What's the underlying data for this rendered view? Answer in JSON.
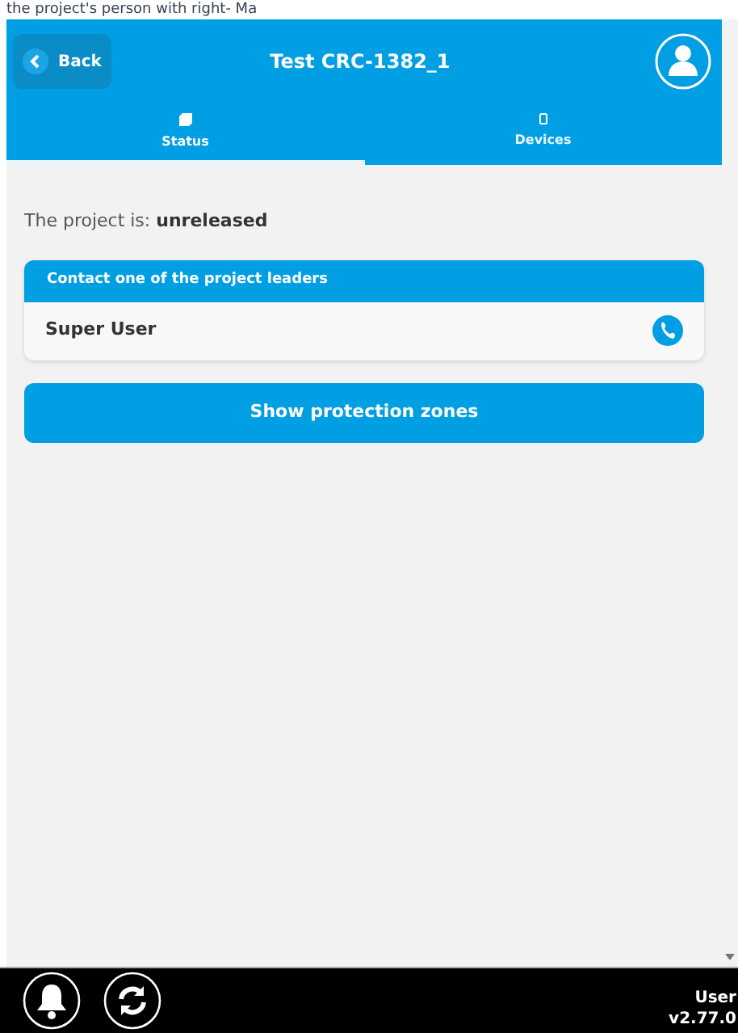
{
  "overlay_text": "the project's person with right- Ma",
  "header": {
    "back": "Back",
    "title": "Test CRC-1382_1"
  },
  "tabs": [
    {
      "label": "Status",
      "selected": true
    },
    {
      "label": "Devices",
      "selected": false
    }
  ],
  "status": {
    "label": "The project is:",
    "value": "unreleased"
  },
  "contact": {
    "title": "Contact one of the project leaders",
    "leaders": [
      "Super User"
    ]
  },
  "zones_button": "Show protection zones",
  "footer": {
    "user": "User",
    "version": "v2.77.0"
  }
}
